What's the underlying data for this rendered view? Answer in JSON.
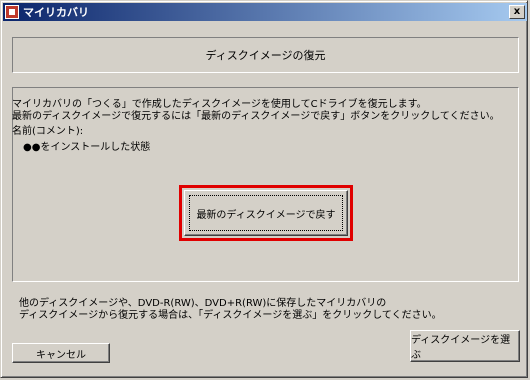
{
  "window": {
    "title": "マイリカバリ",
    "close_glyph": "x"
  },
  "header": {
    "title": "ディスクイメージの復元"
  },
  "main": {
    "description_line1": "マイリカバリの「つくる」で作成したディスクイメージを使用してCドライブを復元します。",
    "description_line2": "最新のディスクイメージで復元するには「最新のディスクイメージで戻す」ボタンをクリックしてください。",
    "name_label": "名前(コメント):",
    "name_value": "●●をインストールした状態",
    "restore_button": "最新のディスクイメージで戻す"
  },
  "footer": {
    "note_line1": "他のディスクイメージや、DVD-R(RW)、DVD+R(RW)に保存したマイリカバリの",
    "note_line2": "ディスクイメージから復元する場合は、「ディスクイメージを選ぶ」をクリックしてください。",
    "cancel_button": "キャンセル",
    "choose_button": "ディスクイメージを選ぶ"
  },
  "colors": {
    "highlight": "#e00000",
    "face": "#d4d0c8"
  }
}
